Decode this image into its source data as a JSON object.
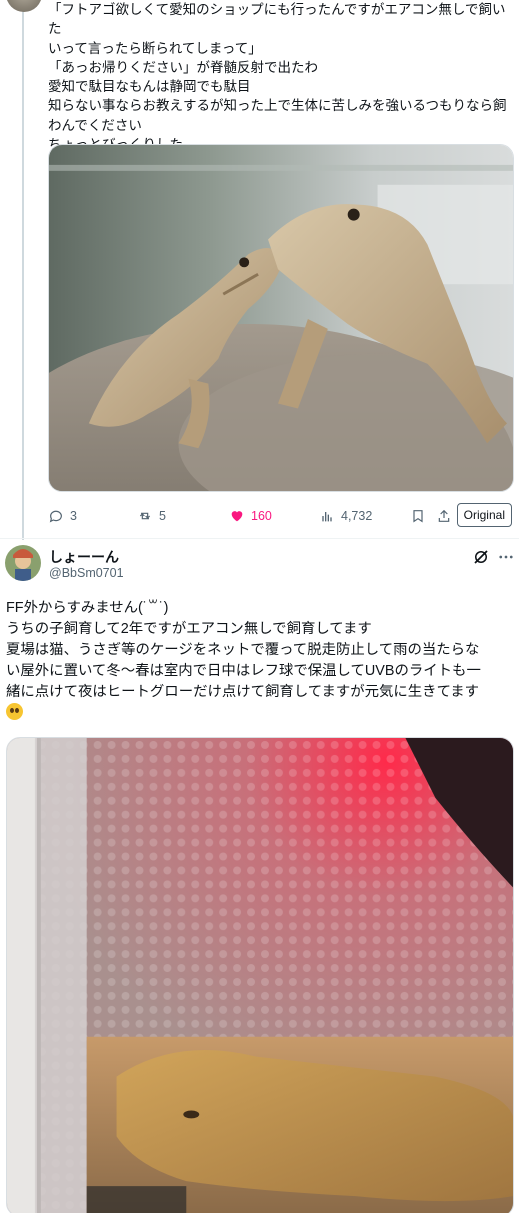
{
  "tweet1": {
    "text_lines": [
      "「フトアゴ欲しくて愛知のショップにも行ったんですがエアコン無しで飼いた",
      "いって言ったら断られてしまって」",
      "「あっお帰りください」が脊髄反射で出たわ",
      "愛知で駄目なもんは静岡でも駄目",
      "知らない事ならお教えするが知った上で生体に苦しみを強いるつもりなら飼",
      "わんでください",
      "ちょっとびっくりした"
    ],
    "image_icon": "bearded-dragons-photo",
    "actions": {
      "replies": "3",
      "reposts": "5",
      "likes": "160",
      "views": "4,732",
      "original_label": "Original"
    }
  },
  "tweet2": {
    "display_name": "しょーーん",
    "handle": "@BbSm0701",
    "text_lines": [
      "FF外からすみません(˙꒳˙)",
      "うちの子飼育して2年ですがエアコン無しで飼育してます",
      "夏場は猫、うさぎ等のケージをネットで覆って脱走防止して雨の当たらな",
      "い屋外に置いて冬〜春は室内で日中はレフ球で保温してUVBのライトも一",
      "緒に点けて夜はヒートグローだけ点けて飼育してますが元気に生きてます"
    ],
    "emoji_icon": "pleading-face-emoji",
    "image_icon": "bearded-dragon-cage-photo"
  },
  "colors": {
    "like": "#f91880",
    "secondary_text": "#536471",
    "divider": "#eff3f4",
    "thread_line": "#cfd9de"
  }
}
